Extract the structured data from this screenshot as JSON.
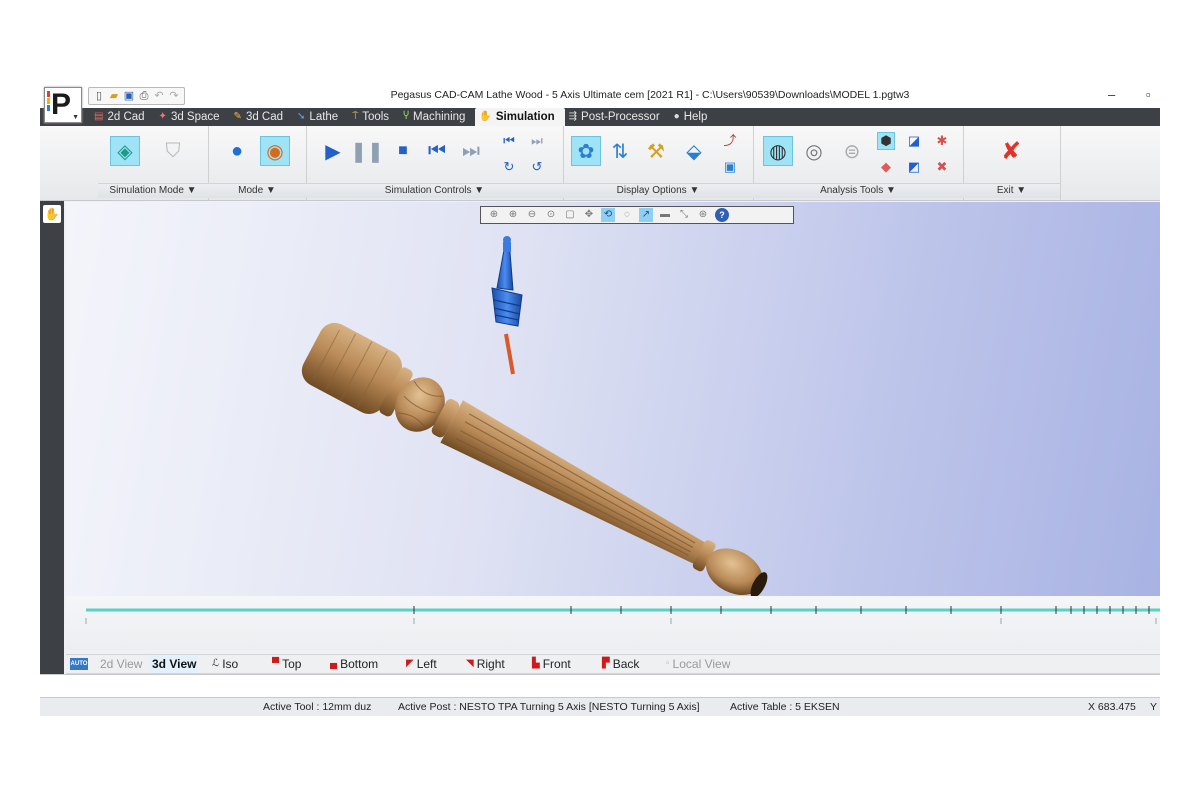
{
  "window": {
    "title": "Pegasus CAD-CAM Lathe Wood - 5 Axis Ultimate cem [2021 R1] - C:\\Users\\90539\\Downloads\\MODEL 1.pgtw3",
    "minimize_glyph": "–",
    "restore_glyph": "▫"
  },
  "logo": {
    "letter": "P"
  },
  "menu": {
    "tabs": [
      {
        "label": "2d Cad",
        "icon": "2d-cad-icon"
      },
      {
        "label": "3d Space",
        "icon": "3d-space-icon"
      },
      {
        "label": "3d Cad",
        "icon": "3d-cad-icon"
      },
      {
        "label": "Lathe",
        "icon": "lathe-icon"
      },
      {
        "label": "Tools",
        "icon": "tools-icon"
      },
      {
        "label": "Machining",
        "icon": "machining-icon"
      },
      {
        "label": "Simulation",
        "icon": "simulation-icon",
        "active": true
      },
      {
        "label": "Post-Processor",
        "icon": "post-processor-icon"
      },
      {
        "label": "Help",
        "icon": "help-icon"
      }
    ]
  },
  "ribbon": {
    "groups": [
      {
        "label": "Simulation Mode ▼"
      },
      {
        "label": "Mode ▼"
      },
      {
        "label": "Simulation Controls ▼"
      },
      {
        "label": "Display Options ▼"
      },
      {
        "label": "Analysis Tools ▼"
      },
      {
        "label": "Exit ▼"
      }
    ]
  },
  "view_toolbar": {
    "icons": [
      "zoom-window-icon",
      "zoom-in-icon",
      "zoom-out-icon",
      "zoom-previous-icon",
      "zoom-all-icon",
      "pan-icon",
      "rotate-icon",
      "orbit-icon",
      "select-icon",
      "fit-icon",
      "measure-icon",
      "zoom-extents-icon",
      "help-icon"
    ]
  },
  "views": {
    "auto": "AUTO",
    "v2d": "2d View",
    "v3d": "3d View",
    "iso": "Iso",
    "top": "Top",
    "bottom": "Bottom",
    "left": "Left",
    "right": "Right",
    "front": "Front",
    "back": "Back",
    "local": "Local View"
  },
  "status": {
    "active_tool": "Active Tool : 12mm duz",
    "active_post": "Active Post : NESTO TPA Turning 5 Axis [NESTO Turning 5 Axis]",
    "active_table": "Active Table : 5 EKSEN",
    "x": "X 683.475",
    "y": "Y"
  },
  "colors": {
    "accent": "#9fe3f6",
    "menubar": "#3d4045",
    "wood": "#b98a57",
    "tool_holder": "#2f6fd0",
    "timeline": "#59d2c4"
  }
}
